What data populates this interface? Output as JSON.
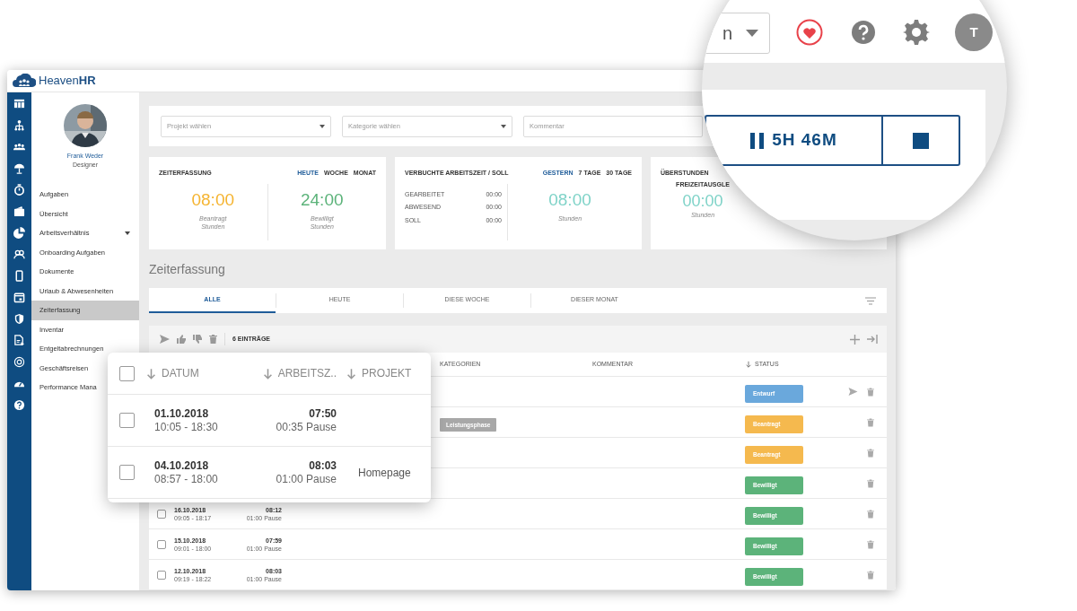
{
  "app": {
    "logo": "Heaven**HR**"
  },
  "sidebar": {
    "user": {
      "name": "Frank Weder",
      "role": "Designer"
    },
    "items": [
      {
        "label": "Aufgaben",
        "selected": false,
        "has_submenu": false
      },
      {
        "label": "Übersicht",
        "selected": false,
        "has_submenu": false
      },
      {
        "label": "Arbeitsverhältnis",
        "selected": false,
        "has_submenu": true
      },
      {
        "label": "Onboarding Aufgaben",
        "selected": false,
        "has_submenu": false
      },
      {
        "label": "Dokumente",
        "selected": false,
        "has_submenu": false
      },
      {
        "label": "Urlaub & Abwesenheiten",
        "selected": false,
        "has_submenu": false
      },
      {
        "label": "Zeiterfassung",
        "selected": true,
        "has_submenu": false
      },
      {
        "label": "Inventar",
        "selected": false,
        "has_submenu": false
      },
      {
        "label": "Entgeltabrechnungen",
        "selected": false,
        "has_submenu": false
      },
      {
        "label": "Geschäftsreisen",
        "selected": false,
        "has_submenu": false
      },
      {
        "label": "Performance Mana",
        "selected": false,
        "has_submenu": false
      }
    ]
  },
  "filter_bar": {
    "fields": [
      {
        "placeholder": "Projekt wählen",
        "kind": "select"
      },
      {
        "placeholder": "Kategorie wählen",
        "kind": "select"
      },
      {
        "placeholder": "Kommentar",
        "kind": "text"
      }
    ]
  },
  "stats_cards": [
    {
      "title": "ZEITERFASSUNG",
      "periods": [
        {
          "label": "HEUTE",
          "selected": true
        },
        {
          "label": "WOCHE",
          "selected": false
        },
        {
          "label": "MONAT",
          "selected": false
        }
      ],
      "values": [
        {
          "value": "08:00",
          "label": "Beantragt Stunden",
          "color": "#f5b431"
        },
        {
          "value": "24:00",
          "label": "Bewilligt Stunden",
          "color": "#5cb37a"
        }
      ]
    },
    {
      "title": "VERBUCHTE ARBEITSZEIT / SOLL",
      "periods": [
        {
          "label": "GESTERN",
          "selected": true
        },
        {
          "label": "7 TAGE",
          "selected": false
        },
        {
          "label": "30 TAGE",
          "selected": false
        }
      ],
      "lines": [
        {
          "label": "GEARBEITET",
          "value": "00:00"
        },
        {
          "label": "ABWESEND",
          "value": "00:00"
        },
        {
          "label": "SOLL",
          "value": "00:00"
        }
      ],
      "values": [
        {
          "value": "08:00",
          "label": "Stunden",
          "color": "#7fd3c8"
        }
      ]
    },
    {
      "title": "ÜBERSTUNDEN",
      "subtitle": "FREIZEITAUSGLE",
      "values": [
        {
          "value": "00:00",
          "label": "Stunden",
          "color": "#7fd3c8"
        }
      ]
    }
  ],
  "section_title": "Zeiterfassung",
  "tabs": [
    {
      "label": "ALLE",
      "selected": true
    },
    {
      "label": "HEUTE",
      "selected": false
    },
    {
      "label": "DIESE WOCHE",
      "selected": false
    },
    {
      "label": "DIESER MONAT",
      "selected": false
    }
  ],
  "table": {
    "count": "6 EINTRÄGE",
    "columns": [
      {
        "label": "KATEGORIEN",
        "sortable": false
      },
      {
        "label": "KOMMENTAR",
        "sortable": false
      },
      {
        "label": "STATUS",
        "sortable": true
      }
    ],
    "rows": [
      {
        "status": "Entwurf",
        "color": "#6aa8dc",
        "can_submit": true
      },
      {
        "status": "Beantragt",
        "color": "#f5b94e",
        "category": "Leistungsphase",
        "can_submit": false
      },
      {
        "status": "Beantragt",
        "color": "#f5b94e",
        "can_submit": false
      },
      {
        "status": "Bewilligt",
        "color": "#5cb37a",
        "can_submit": false
      },
      {
        "checked": false,
        "date": "16.10.2018",
        "time": "09:05 - 18:17",
        "hours": "08:12",
        "pause": "01:00 Pause",
        "status": "Bewilligt",
        "color": "#5cb37a",
        "can_submit": false
      },
      {
        "checked": false,
        "date": "15.10.2018",
        "time": "09:01 - 18:00",
        "hours": "07:59",
        "pause": "01:00 Pause",
        "status": "Bewilligt",
        "color": "#5cb37a",
        "can_submit": false
      },
      {
        "checked": false,
        "date": "12.10.2018",
        "time": "09:19 - 18:22",
        "hours": "08:03",
        "pause": "01:00 Pause",
        "status": "Bewilligt",
        "color": "#5cb37a",
        "can_submit": false
      }
    ]
  },
  "zoom_card": {
    "checked": false,
    "columns": [
      {
        "label": "DATUM",
        "sortable": true
      },
      {
        "label": "ARBEITSZ..",
        "sortable": true
      },
      {
        "label": "PROJEKT",
        "sortable": true
      }
    ],
    "rows": [
      {
        "checked": false,
        "date": "01.10.2018",
        "time": "10:05 - 18:30",
        "hours": "07:50",
        "pause": "00:35 Pause"
      },
      {
        "checked": false,
        "date": "04.10.2018",
        "time": "08:57 - 18:00",
        "hours": "08:03",
        "pause": "01:00 Pause",
        "project": "Homepage"
      }
    ]
  },
  "magnifier": {
    "dropdown_text": "n",
    "avatar": "T",
    "timer": "5H 46M"
  }
}
